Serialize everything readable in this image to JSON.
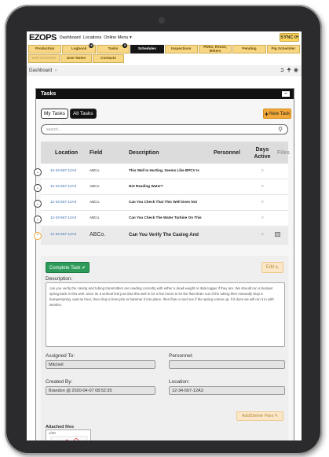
{
  "app": {
    "logo_main": "EZOPS",
    "menu": [
      "Dashboard",
      "Locations",
      "Online Menu ▾"
    ],
    "sync_label": "SYNC"
  },
  "nav": {
    "row1": [
      {
        "label": "Production",
        "style": "gold"
      },
      {
        "label": "Logbook",
        "style": "gold",
        "badge": "16"
      },
      {
        "label": "Tasks",
        "style": "gold",
        "badge": "5"
      },
      {
        "label": "Schedules",
        "style": "dark"
      },
      {
        "label": "Inspections",
        "style": "gold"
      },
      {
        "label": "PDEs, Reuse, Meters",
        "style": "gold"
      },
      {
        "label": "Pending",
        "style": "gold"
      },
      {
        "label": "Pig Scheduler",
        "style": "gold"
      }
    ],
    "row2": [
      {
        "label": "Well Schedule",
        "style": "muted"
      },
      {
        "label": "User Notes",
        "style": "gold"
      },
      {
        "label": "Contacts",
        "style": "gold"
      }
    ]
  },
  "breadcrumb": {
    "label": "Dashboard",
    "sep": "»"
  },
  "panel": {
    "title": "Tasks",
    "minimize": "–",
    "tabs": [
      "My Tasks",
      "All Tasks"
    ],
    "new_task": "New Task",
    "search_placeholder": "search..."
  },
  "table": {
    "headers": {
      "location": "Location",
      "field": "Field",
      "description": "Description",
      "personnel": "Personnel",
      "days": "Days Active",
      "files": "Files"
    },
    "rows": [
      {
        "location": "12-34-567-12A3",
        "field": "ABCo.",
        "description": "This Well Is Hurting, Seems Like BPCV Is",
        "personnel": "",
        "days": "0",
        "expand": "⌄"
      },
      {
        "location": "12-34-567-12A3",
        "field": "ABCo.",
        "description": "Not Reading Water?",
        "personnel": "",
        "days": "0",
        "expand": "⌄"
      },
      {
        "location": "12-34-567-12A3",
        "field": "ABCo.",
        "description": "Can You Check That This Well Does Not",
        "personnel": "",
        "days": "0",
        "expand": "⌄"
      },
      {
        "location": "12-34-567-12A3",
        "field": "ABCo.",
        "description": "Can You Check The Water Turbine On This",
        "personnel": "",
        "days": "0",
        "expand": "⌄"
      },
      {
        "location": "12-34-567-12A3",
        "field": "ABCo.",
        "description": "Can You Verify The Casing And",
        "personnel": "",
        "days": "0",
        "expand": "⌃"
      }
    ]
  },
  "detail": {
    "complete_label": "Complete Task ✔",
    "edit_label": "Edit",
    "description_label": "Description:",
    "description_text": "can you verify the casing and tubing transmitters are reading correctly with either a dead weight or data logger if they are. We should run a bumper spring back in this well. since its a vertical lets just shut this well in for a few hours to let the fluid drain out of the tubing then manually drop a bumperspring. wait an hour, then drop a freecycle to hammer it into place. then flow or and see if the spring comes up. if it does we will run it in with wireline.",
    "assigned_label": "Assigned To:",
    "assigned_value": "Mitchell",
    "personnel_label": "Personnel:",
    "personnel_value": "",
    "created_label": "Created By:",
    "created_value": "Brandon @ 2020-04-07 08:52:35",
    "location_label": "Location:",
    "location_value": "12-34-567-12A3",
    "add_delete_label": "Add/Delete Files",
    "attached_label": "Attached files",
    "attachment_page": "1/20"
  },
  "colors": {
    "accent": "#f3a93a",
    "gold_nav": "#f7d784",
    "complete": "#2f9b5b",
    "link": "#3b6fb0"
  }
}
